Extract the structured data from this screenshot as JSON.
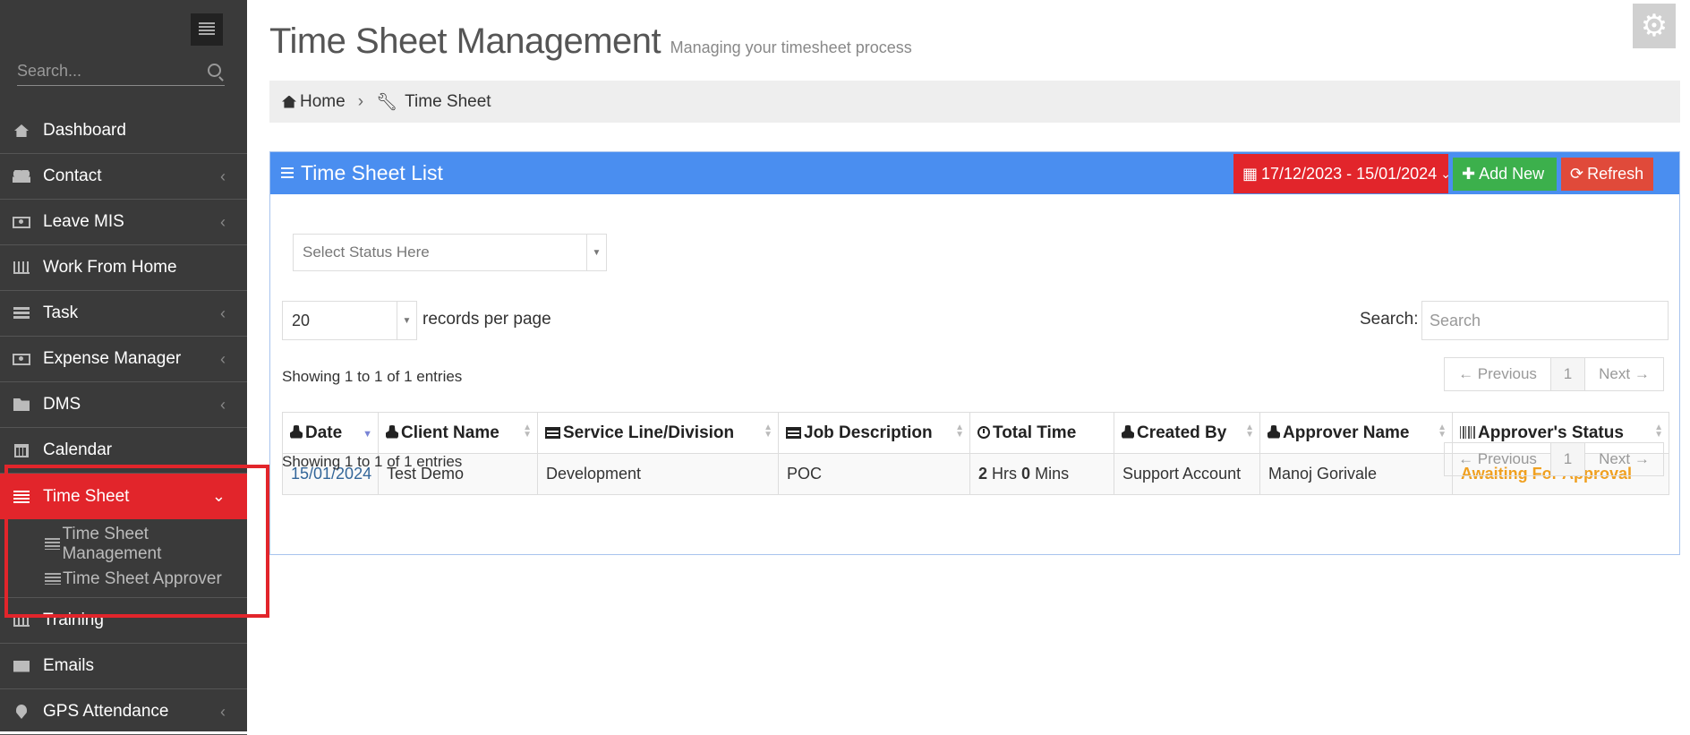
{
  "sidebar": {
    "search_placeholder": "Search...",
    "items": [
      {
        "label": "Dashboard",
        "icon": "home-icon"
      },
      {
        "label": "Contact",
        "icon": "users-icon"
      },
      {
        "label": "Leave MIS",
        "icon": "money-icon"
      },
      {
        "label": "Work From Home",
        "icon": "bar-chart-icon"
      },
      {
        "label": "Task",
        "icon": "tasks-icon"
      },
      {
        "label": "Expense Manager",
        "icon": "money-icon"
      },
      {
        "label": "DMS",
        "icon": "folder-icon"
      },
      {
        "label": "Calendar",
        "icon": "calendar-icon"
      },
      {
        "label": "Time Sheet",
        "icon": "list-icon"
      },
      {
        "label": "Training",
        "icon": "bar-chart-icon"
      },
      {
        "label": "Emails",
        "icon": "envelope-icon"
      },
      {
        "label": "GPS Attendance",
        "icon": "map-pin-icon"
      }
    ],
    "submenu": [
      "Time Sheet Management",
      "Time Sheet Approver"
    ],
    "active_color": "#e2252b"
  },
  "header": {
    "title": "Time Sheet Management",
    "subtitle": "Managing your timesheet process"
  },
  "breadcrumb": {
    "home": "Home",
    "current": "Time Sheet"
  },
  "panel": {
    "title": "Time Sheet List",
    "date_range": "17/12/2023 - 15/01/2024",
    "add_label": "Add New",
    "refresh_label": "Refresh",
    "status_placeholder": "Select Status Here",
    "page_length": "20",
    "records_per_page": "records per page",
    "search_label": "Search:",
    "search_placeholder": "Search",
    "info_top": "Showing 1 to 1 of 1 entries",
    "info_bottom": "Showing 1 to 1 of 1 entries",
    "pager": {
      "previous": "← Previous",
      "page": "1",
      "next": "Next →"
    }
  },
  "table": {
    "columns": [
      "Date",
      "Client Name",
      "Service Line/Division",
      "Job Description",
      "Total Time",
      "Created By",
      "Approver Name",
      "Approver's Status"
    ],
    "rows": [
      {
        "date": "15/01/2024",
        "client": "Test Demo",
        "service": "Development",
        "job": "POC",
        "hrs": "2",
        "hrs_unit": "Hrs",
        "mins": "0",
        "mins_unit": "Mins",
        "created_by": "Support Account",
        "approver": "Manoj Gorivale",
        "status": "Awaiting For Approval"
      }
    ]
  },
  "colors": {
    "panel_header": "#4a8ef0",
    "date_button": "#e2252b",
    "add_button": "#3cb04c",
    "refresh_button": "#e04a3a",
    "status_awaiting": "#f0a020"
  }
}
